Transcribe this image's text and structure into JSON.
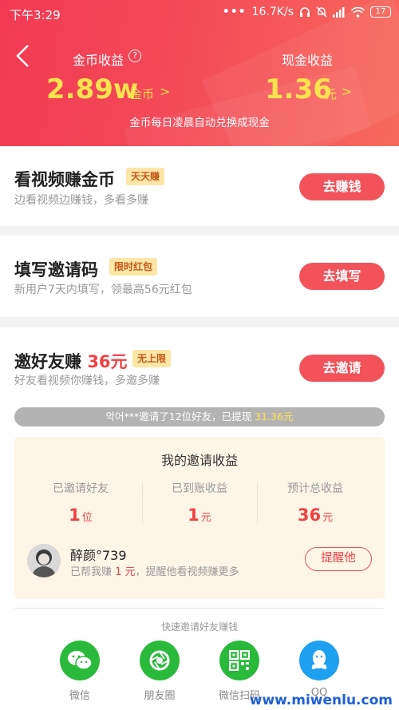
{
  "status_bar": {
    "time": "下午3:29",
    "net_speed": "16.7K/s",
    "battery": "17"
  },
  "header": {
    "coin_label": "金币收益",
    "help_icon": "?",
    "coin_value": "2.89w",
    "coin_unit": "金币",
    "chevron": ">",
    "cash_label": "现金收益",
    "cash_value": "1.36",
    "cash_unit": "元",
    "notice": "金币每日凌晨自动兑换成现金"
  },
  "tasks": [
    {
      "title": "看视频赚金币",
      "badge": "天天赚",
      "subtitle": "边看视频边赚钱，多看多赚",
      "button": "去赚钱"
    },
    {
      "title": "填写邀请码",
      "badge": "限时红包",
      "subtitle": "新用户7天内填写，领最高56元红包",
      "button": "去填写"
    },
    {
      "title": "邀好友赚",
      "title_amount": "36元",
      "badge": "无上限",
      "subtitle": "好友看视频你赚钱，多邀多赚",
      "button": "去邀请"
    }
  ],
  "ticker": {
    "text": "악어***邀请了12位好友，已提现 ",
    "amount": "31.36元"
  },
  "earnings": {
    "title": "我的邀请收益",
    "stats": [
      {
        "label": "已邀请好友",
        "value": "1",
        "unit": "位"
      },
      {
        "label": "已到账收益",
        "value": "1",
        "unit": "元"
      },
      {
        "label": "预计总收益",
        "value": "36",
        "unit": "元"
      }
    ],
    "friend": {
      "name": "醉颜°739",
      "sub_prefix": "已帮我赚 ",
      "sub_amount": "1 元",
      "sub_suffix": "，提醒他看视频赚更多",
      "button": "提醒他"
    }
  },
  "share": {
    "title": "快速邀请好友赚钱",
    "items": [
      {
        "label": "微信",
        "icon": "wechat-icon",
        "color": "#2aba3b"
      },
      {
        "label": "朋友圈",
        "icon": "moments-icon",
        "color": "#2aba3b"
      },
      {
        "label": "微信扫码",
        "icon": "qr-code-icon",
        "color": "#2aba3b"
      },
      {
        "label": "QQ",
        "icon": "qq-icon",
        "color": "#1ea0f1"
      }
    ]
  },
  "watermark": "www.miwenlu.com",
  "colors": {
    "header_red": "#f13a52",
    "accent_red": "#f2535b",
    "yellow": "#ffe34d",
    "green": "#2aba3b",
    "blue": "#1ea0f1"
  }
}
